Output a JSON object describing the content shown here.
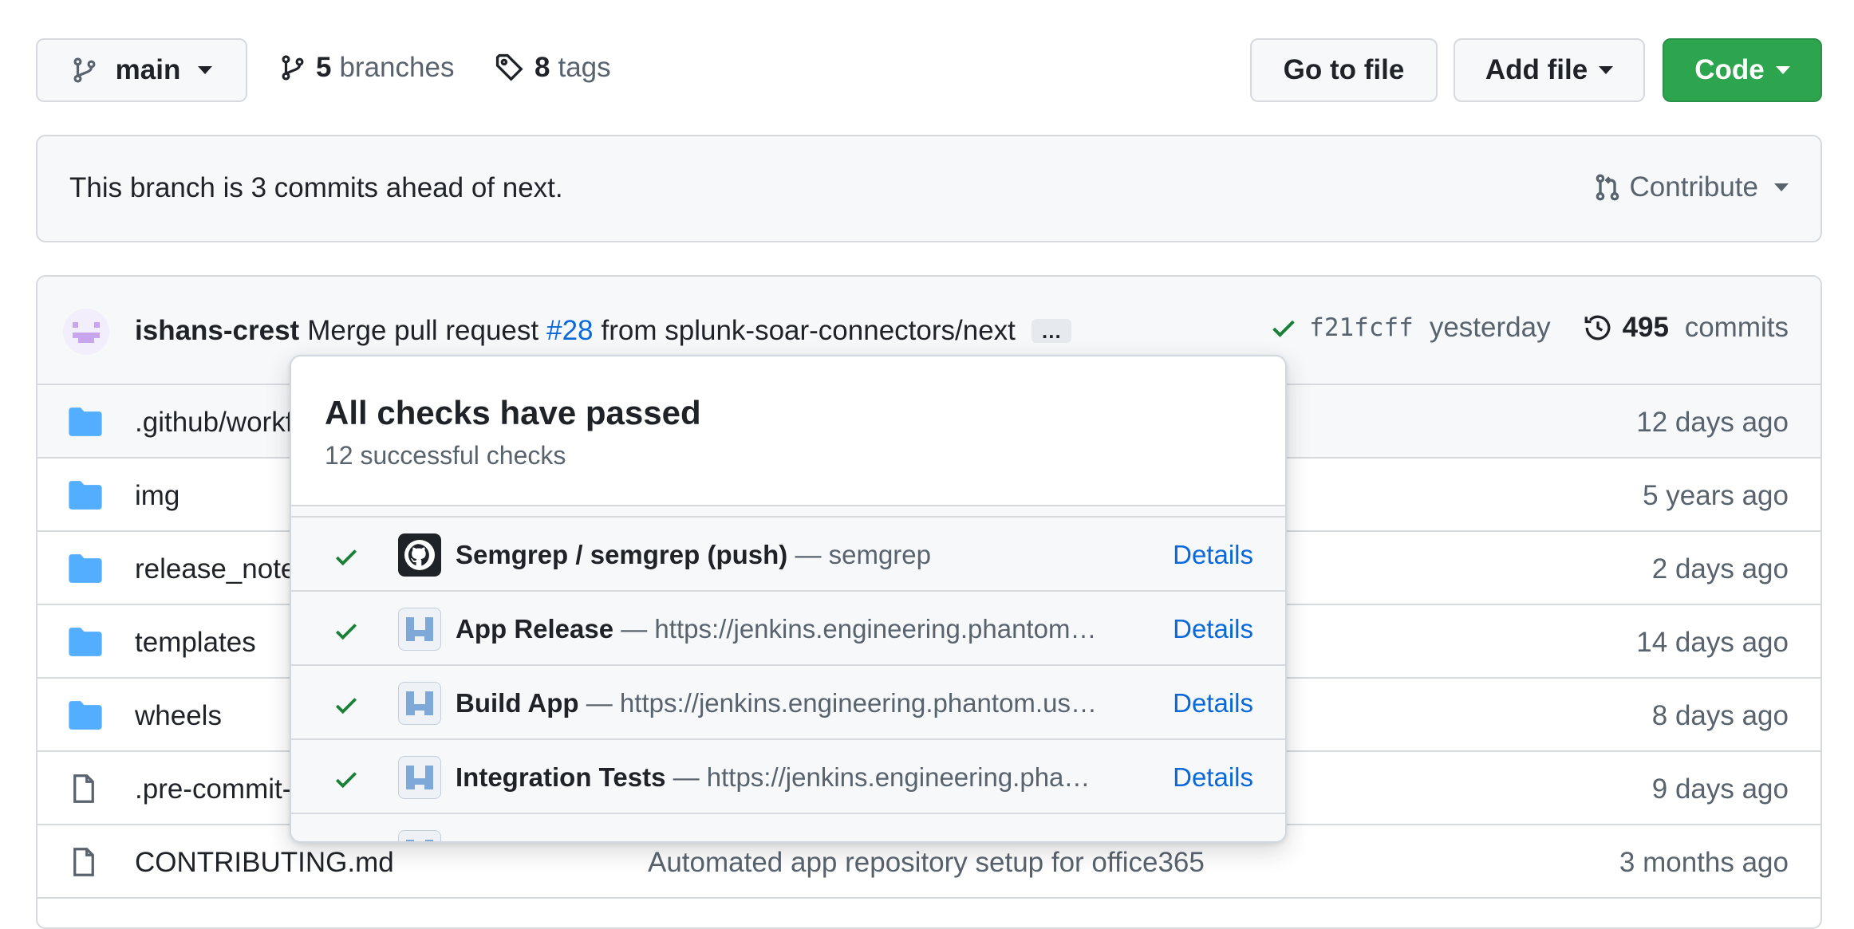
{
  "toolbar": {
    "branch": "main",
    "branches_count": "5",
    "branches_label": "branches",
    "tags_count": "8",
    "tags_label": "tags",
    "go_to_file": "Go to file",
    "add_file": "Add file",
    "code": "Code"
  },
  "banner": {
    "text": "This branch is 3 commits ahead of next.",
    "contribute": "Contribute"
  },
  "latest_commit": {
    "author": "ishans-crest",
    "message_prefix": "Merge pull request",
    "pr": "#28",
    "message_suffix": "from splunk-soar-connectors/next",
    "ellipsis": "…",
    "sha": "f21fcff",
    "time": "yesterday",
    "commits_count": "495",
    "commits_label": "commits"
  },
  "files": [
    {
      "name": ".github/workflows",
      "message": "",
      "age": "12 days ago",
      "type": "folder"
    },
    {
      "name": "img",
      "message": "",
      "age": "5 years ago",
      "type": "folder"
    },
    {
      "name": "release_notes",
      "message": "",
      "age": "2 days ago",
      "type": "folder"
    },
    {
      "name": "templates",
      "message": "",
      "age": "14 days ago",
      "type": "folder"
    },
    {
      "name": "wheels",
      "message": "",
      "age": "8 days ago",
      "type": "folder"
    },
    {
      "name": ".pre-commit-config.yaml",
      "message": "",
      "age": "9 days ago",
      "type": "file"
    },
    {
      "name": "CONTRIBUTING.md",
      "message": "Automated app repository setup for office365",
      "age": "3 months ago",
      "type": "file"
    }
  ],
  "checks_popover": {
    "title": "All checks have passed",
    "subtitle": "12 successful checks",
    "details_label": "Details",
    "items": [
      {
        "name": "Semgrep / semgrep (push)",
        "desc": "— semgrep",
        "logo": "github-icon"
      },
      {
        "name": "App Release",
        "desc": "— https://jenkins.engineering.phantom.us/job/app-release",
        "logo": "jenkins-icon"
      },
      {
        "name": "Build App",
        "desc": "— https://jenkins.engineering.phantom.us/job/build-app",
        "logo": "jenkins-icon"
      },
      {
        "name": "Integration Tests",
        "desc": "— https://jenkins.engineering.phantom.us/job/integration-tests",
        "logo": "jenkins-icon"
      },
      {
        "name": "",
        "desc": "",
        "logo": "jenkins-icon"
      }
    ]
  },
  "colors": {
    "accent_blue": "#0969da",
    "success_green": "#1a7f37",
    "code_button": "#2da44e",
    "folder_blue": "#54aeff"
  }
}
